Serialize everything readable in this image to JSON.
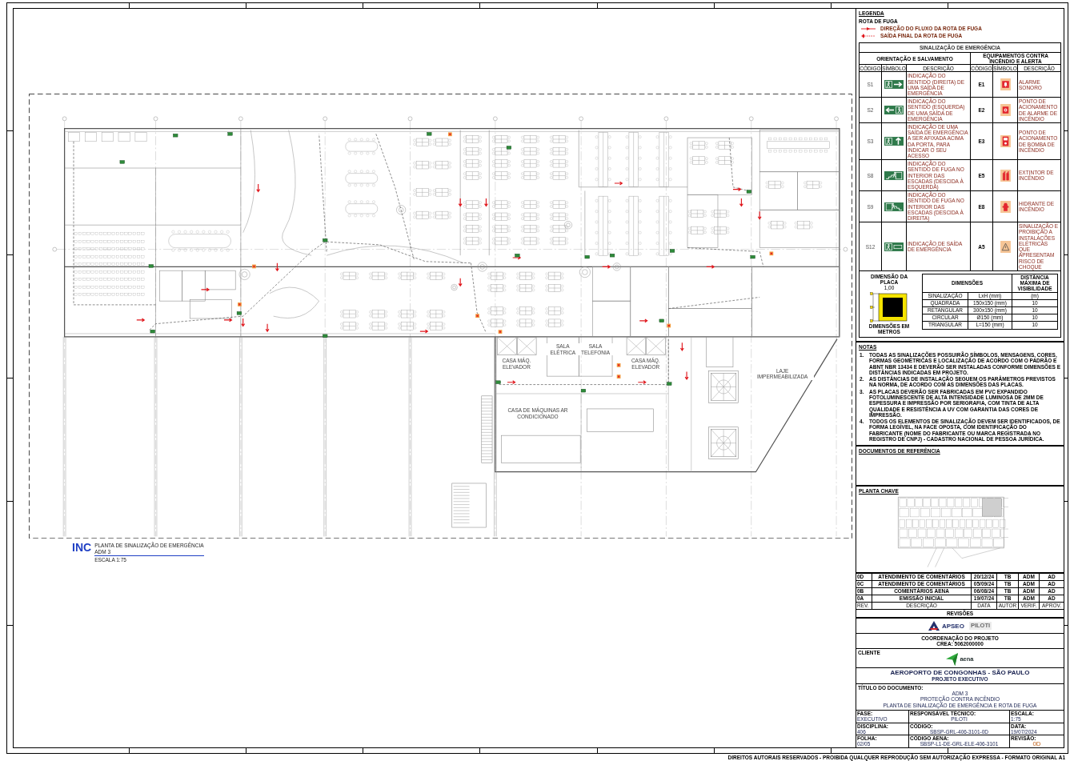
{
  "plan": {
    "room_labels": [
      "SALA ELÉTRICA",
      "SALA TELEFONIA",
      "CASA MÁQ. ELEVADOR",
      "CASA MÁQ. ELEVADOR",
      "CASA DE MÁQUINAS AR CONDICIONADO",
      "LAJE IMPERMEABILIZADA"
    ],
    "title_tag": {
      "code": "INC",
      "title": "PLANTA DE SINALIZAÇÃO DE EMERGÊNCIA",
      "subtitle": "ADM 3",
      "scale": "ESCALA 1:75"
    }
  },
  "legend": {
    "title": "LEGENDA",
    "route_heading": "ROTA DE FUGA",
    "route_items": [
      {
        "kind": "solid",
        "label": "DIREÇÃO DO FLUXO DA ROTA DE FUGA"
      },
      {
        "kind": "dashed",
        "label": "SAÍDA FINAL DA ROTA DE FUGA"
      }
    ],
    "signs": {
      "title": "SINALIZAÇÃO DE EMERGÊNCIA",
      "groups": [
        "ORIENTAÇÃO E SALVAMENTO",
        "EQUIPAMENTOS CONTRA INCÊNDIO E ALERTA"
      ],
      "columns": [
        "CÓDIGO",
        "SÍMBOLO",
        "DESCRIÇÃO",
        "CÓDIGO",
        "SÍMBOLO",
        "DESCRIÇÃO"
      ],
      "rows": [
        {
          "code": "S1",
          "description": "INDICAÇÃO DO SENTIDO (DIREITA) DE UMA SAÍDA DE EMERGÊNCIA",
          "equipment_code": "E1",
          "equipment_description": "ALARME SONORO"
        },
        {
          "code": "S2",
          "description": "INDICAÇÃO DO SENTIDO (ESQUERDA) DE UMA SAÍDA DE EMERGÊNCIA",
          "equipment_code": "E2",
          "equipment_description": "PONTO DE ACIONAMENTO DE ALARME DE INCÊNDIO"
        },
        {
          "code": "S3",
          "description": "INDICAÇÃO DE UMA SAÍDA DE EMERGÊNCIA A SER AFIXADA ACIMA DA PORTA, PARA INDICAR O SEU ACESSO",
          "equipment_code": "E3",
          "equipment_description": "PONTO DE ACIONAMENTO DE BOMBA DE INCÊNDIO"
        },
        {
          "code": "S8",
          "description": "INDICAÇÃO DO SENTIDO DE FUGA NO INTERIOR DAS ESCADAS (DESCIDA À ESQUERDA)",
          "equipment_code": "E5",
          "equipment_description": "EXTINTOR DE INCÊNDIO"
        },
        {
          "code": "S9",
          "description": "INDICAÇÃO DO SENTIDO DE FUGA NO INTERIOR DAS ESCADAS (DESCIDA À DIREITA)",
          "equipment_code": "E8",
          "equipment_description": "HIDRANTE DE INCÊNDIO"
        },
        {
          "code": "S12",
          "description": "INDICAÇÃO DE SAÍDA DE EMERGÊNCIA",
          "equipment_code": "A5",
          "equipment_description": "SINALIZAÇÃO E PROIBIÇÃO A INSTALAÇÕES ELÉTRICAS QUE APRESENTAM RISCO DE CHOQUE"
        }
      ]
    },
    "plate": {
      "title": "DIMENSÃO DA PLACA",
      "size": "1,00",
      "caption": "DIMENSÕES EM METROS",
      "columns": [
        "DIMENSÕES",
        "",
        "DISTÂNCIA MÁXIMA DE VISIBILIDADE"
      ],
      "rows": [
        [
          "SINALIZAÇÃO",
          "LxH (mm)",
          "(m)"
        ],
        [
          "QUADRADA",
          "150x150 (mm)",
          "10"
        ],
        [
          "RETANGULAR",
          "300x150 (mm)",
          "10"
        ],
        [
          "CIRCULAR",
          "Ø150 (mm)",
          "10"
        ],
        [
          "TRIANGULAR",
          "L=150 (mm)",
          "10"
        ]
      ]
    }
  },
  "notes": {
    "title": "NOTAS",
    "items": [
      {
        "number": "1.",
        "text": "TODAS AS SINALIZAÇÕES POSSUIRÃO SÍMBOLOS, MENSAGENS, CORES, FORMAS GEOMÉTRICAS E LOCALIZAÇÃO DE ACORDO COM O PADRÃO E ABNT NBR 13434 E DEVERÃO SER INSTALADAS CONFORME DIMENSÕES E DISTÂNCIAS INDICADAS EM PROJETO."
      },
      {
        "number": "2.",
        "text": "AS DISTÂNCIAS DE INSTALAÇÃO SEGUEM OS PARÂMETROS PREVISTOS NA NORMA, DE ACORDO COM AS DIMENSÕES DAS PLACAS."
      },
      {
        "number": "3.",
        "text": "AS PLACAS DEVERÃO SER FABRICADAS EM PVC EXPANDIDO FOTOLUMINESCENTE DE ALTA INTENSIDADE LUMINOSA DE 2MM DE ESPESSURA E IMPRESSÃO POR SERIGRAFIA, COM TINTA DE ALTA QUALIDADE E RESISTÊNCIA A UV COM GARANTIA DAS CORES DE IMPRESSÃO."
      },
      {
        "number": "4.",
        "text": "TODOS OS ELEMENTOS DE SINALIZAÇÃO DEVEM SER IDENTIFICADOS, DE FORMA LEGÍVEL, NA FACE OPOSTA, COM IDENTIFICAÇÃO DO FABRICANTE (NOME DO FABRICANTE OU MARCA REGISTRADA NO REGISTRO DE CNPJ) - CADASTRO NACIONAL DE PESSOA JURÍDICA."
      }
    ]
  },
  "references": {
    "title": "DOCUMENTOS DE REFERÊNCIA"
  },
  "key_plan": {
    "title": "PLANTA CHAVE"
  },
  "revisions": {
    "rows": [
      {
        "kind": "entry",
        "cells": [
          "0D",
          "ATENDIMENTO DE COMENTÁRIOS",
          "20/12/24",
          "TB",
          "ADM",
          "AD"
        ]
      },
      {
        "kind": "entry",
        "cells": [
          "0C",
          "ATENDIMENTO DE COMENTÁRIOS",
          "05/09/24",
          "TB",
          "ADM",
          "AD"
        ]
      },
      {
        "kind": "entry",
        "cells": [
          "0B",
          "COMENTÁRIOS AENA",
          "06/08/24",
          "TB",
          "ADM",
          "AD"
        ]
      },
      {
        "kind": "entry",
        "cells": [
          "0A",
          "EMISSÃO INICIAL",
          "19/07/24",
          "TB",
          "ADM",
          "AD"
        ]
      },
      {
        "kind": "header",
        "cells": [
          "REV.",
          "DESCRIÇÃO",
          "DATA",
          "AUTOR",
          "VERIF.",
          "APROV."
        ]
      }
    ],
    "title": "REVISÕES"
  },
  "designers": {
    "company": "APSEO",
    "partner": "PILOTI",
    "coordination": [
      "COORDENAÇÃO DO PROJETO",
      "CREA: 5062000000"
    ]
  },
  "client": {
    "label": "CLIENTE",
    "name": "aena"
  },
  "project": {
    "name": "AEROPORTO DE CONGONHAS - SÃO PAULO",
    "phase": "PROJETO EXECUTIVO"
  },
  "document": {
    "label": "TÍTULO DO DOCUMENTO:",
    "lines": [
      "ADM 3",
      "PROTEÇÃO CONTRA INCÊNDIO",
      "PLANTA DE SINALIZAÇÃO DE EMERGÊNCIA E ROTA DE FUGA"
    ]
  },
  "info": [
    {
      "label": "FASE:",
      "value": "EXECUTIVO"
    },
    {
      "label": "RESPONSÁVEL TÉCNICO:",
      "value": "PILOTI"
    },
    {
      "label": "ESCALA:",
      "value": "1:75"
    },
    {
      "label": "DISCIPLINA:",
      "value": "406"
    },
    {
      "label": "CÓDIGO:",
      "value": "SBSP-GRL-406-3101-0D"
    },
    {
      "label": "DATA:",
      "value": "19/07/2024"
    },
    {
      "label": "FOLHA:",
      "value": "02/05"
    },
    {
      "label": "CÓDIGO AENA:",
      "value": "SBSP-L1-DE-GRL-ELE-406-3101"
    },
    {
      "label": "REVISÃO:",
      "value": "0D"
    }
  ],
  "footer": "DIREITOS AUTORAIS RESERVADOS - PROIBIDA QUALQUER REPRODUÇÃO SEM AUTORIZAÇÃO EXPRESSA - FORMATO ORIGINAL A1"
}
